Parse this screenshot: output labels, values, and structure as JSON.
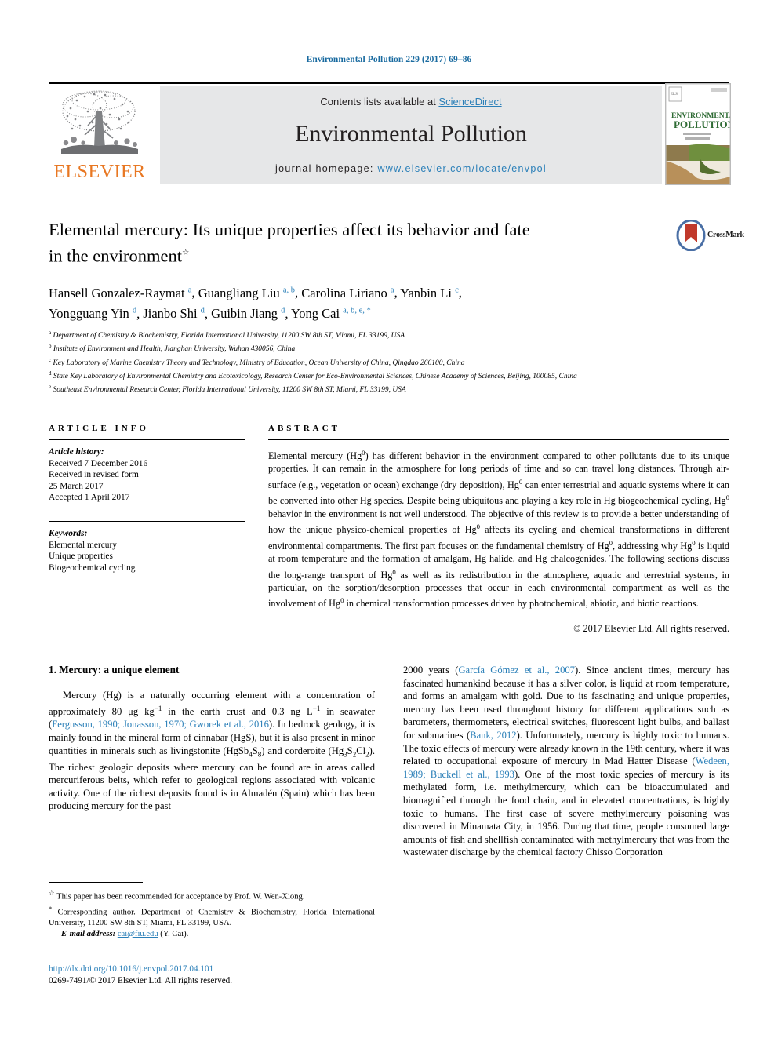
{
  "running_head": "Environmental Pollution 229 (2017) 69–86",
  "masthead": {
    "contents_prefix": "Contents lists available at ",
    "sciencedirect": "ScienceDirect",
    "journal_name": "Environmental Pollution",
    "homepage_prefix": "journal homepage: ",
    "homepage_url": "www.elsevier.com/locate/envpol",
    "publisher": "ELSEVIER",
    "cover_title_line1": "ENVIRONMENTAL",
    "cover_title_line2": "POLLUTION",
    "link_color": "#2a7fb8",
    "publisher_color": "#e87722"
  },
  "article": {
    "title_line1": "Elemental mercury: Its unique properties affect its behavior and fate",
    "title_line2": "in the environment",
    "title_footnote_mark": "☆",
    "crossmark_label": "CrossMark"
  },
  "authors": [
    {
      "name": "Hansell Gonzalez-Raymat",
      "marks": "a",
      "sep": ", "
    },
    {
      "name": "Guangliang Liu",
      "marks": "a, b",
      "sep": ", "
    },
    {
      "name": "Carolina Liriano",
      "marks": "a",
      "sep": ", "
    },
    {
      "name": "Yanbin Li",
      "marks": "c",
      "sep": ", "
    },
    {
      "name": "Yongguang Yin",
      "marks": "d",
      "sep": ", "
    },
    {
      "name": "Jianbo Shi",
      "marks": "d",
      "sep": ", "
    },
    {
      "name": "Guibin Jiang",
      "marks": "d",
      "sep": ", "
    },
    {
      "name": "Yong Cai",
      "marks": "a, b, e, *",
      "sep": ""
    }
  ],
  "affiliations": [
    {
      "mark": "a",
      "text": "Department of Chemistry & Biochemistry, Florida International University, 11200 SW 8th ST, Miami, FL 33199, USA"
    },
    {
      "mark": "b",
      "text": "Institute of Environment and Health, Jianghan University, Wuhan 430056, China"
    },
    {
      "mark": "c",
      "text": "Key Laboratory of Marine Chemistry Theory and Technology, Ministry of Education, Ocean University of China, Qingdao 266100, China"
    },
    {
      "mark": "d",
      "text": "State Key Laboratory of Environmental Chemistry and Ecotoxicology, Research Center for Eco-Environmental Sciences, Chinese Academy of Sciences, Beijing, 100085, China"
    },
    {
      "mark": "e",
      "text": "Southeast Environmental Research Center, Florida International University, 11200 SW 8th ST, Miami, FL 33199, USA"
    }
  ],
  "article_info": {
    "heading": "ARTICLE INFO",
    "history_label": "Article history:",
    "history_lines": [
      "Received 7 December 2016",
      "Received in revised form",
      "25 March 2017",
      "Accepted 1 April 2017"
    ],
    "keywords_label": "Keywords:",
    "keywords": [
      "Elemental mercury",
      "Unique properties",
      "Biogeochemical cycling"
    ]
  },
  "abstract": {
    "heading": "ABSTRACT",
    "text": "Elemental mercury (Hg0) has different behavior in the environment compared to other pollutants due to its unique properties. It can remain in the atmosphere for long periods of time and so can travel long distances. Through air-surface (e.g., vegetation or ocean) exchange (dry deposition), Hg0 can enter terrestrial and aquatic systems where it can be converted into other Hg species. Despite being ubiquitous and playing a key role in Hg biogeochemical cycling, Hg0 behavior in the environment is not well understood. The objective of this review is to provide a better understanding of how the unique physico-chemical properties of Hg0 affects its cycling and chemical transformations in different environmental compartments. The first part focuses on the fundamental chemistry of Hg0, addressing why Hg0 is liquid at room temperature and the formation of amalgam, Hg halide, and Hg chalcogenides. The following sections discuss the long-range transport of Hg0 as well as its redistribution in the atmosphere, aquatic and terrestrial systems, in particular, on the sorption/desorption processes that occur in each environmental compartment as well as the involvement of Hg0 in chemical transformation processes driven by photochemical, abiotic, and biotic reactions.",
    "copyright": "© 2017 Elsevier Ltd. All rights reserved."
  },
  "body": {
    "section_number_title": "1. Mercury: a unique element",
    "left_paragraph_1": "Mercury (Hg) is a naturally occurring element with a concentration of approximately 80 μg kg−1 in the earth crust and 0.3 ng L−1 in seawater (Fergusson, 1990; Jonasson, 1970; Gworek et al., 2016). In bedrock geology, it is mainly found in the mineral form of cinnabar (HgS), but it is also present in minor quantities in minerals such as livingstonite (HgSb4S8) and corderoite (Hg3S2Cl2). The richest geologic deposits where mercury can be found are in areas called mercuriferous belts, which refer to geological regions associated with volcanic activity. One of the richest deposits found is in Almadén (Spain) which has been producing mercury for the past",
    "right_paragraph_1": "2000 years (García Gómez et al., 2007). Since ancient times, mercury has fascinated humankind because it has a silver color, is liquid at room temperature, and forms an amalgam with gold. Due to its fascinating and unique properties, mercury has been used throughout history for different applications such as barometers, thermometers, electrical switches, fluorescent light bulbs, and ballast for submarines (Bank, 2012). Unfortunately, mercury is highly toxic to humans. The toxic effects of mercury were already known in the 19th century, where it was related to occupational exposure of mercury in Mad Hatter Disease (Wedeen, 1989; Buckell et al., 1993). One of the most toxic species of mercury is its methylated form, i.e. methylmercury, which can be bioaccumulated and biomagnified through the food chain, and in elevated concentrations, is highly toxic to humans. The first case of severe methylmercury poisoning was discovered in Minamata City, in 1956. During that time, people consumed large amounts of fish and shellfish contaminated with methylmercury that was from the wastewater discharge by the chemical factory Chisso Corporation"
  },
  "footnotes": {
    "star_mark": "☆",
    "star_text": "This paper has been recommended for acceptance by Prof. W. Wen-Xiong.",
    "corr_mark": "*",
    "corr_text": "Corresponding author. Department of Chemistry & Biochemistry, Florida International University, 11200 SW 8th ST, Miami, FL 33199, USA.",
    "email_label": "E-mail address:",
    "email": "cai@fiu.edu",
    "email_suffix": "(Y. Cai)."
  },
  "footer": {
    "doi": "http://dx.doi.org/10.1016/j.envpol.2017.04.101",
    "issn_line": "0269-7491/© 2017 Elsevier Ltd. All rights reserved."
  }
}
